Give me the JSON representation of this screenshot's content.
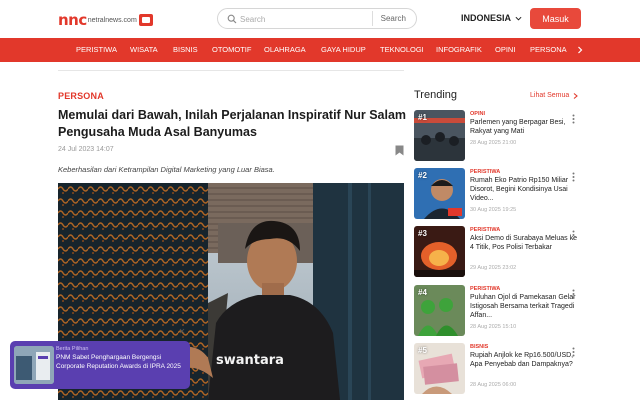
{
  "header": {
    "logo_text": "nnc",
    "logo_sub": "netralnews.com",
    "search_placeholder": "Search",
    "search_button": "Search",
    "language": "INDONESIA",
    "login_button": "Masuk"
  },
  "nav": {
    "items": [
      "PERISTIWA",
      "WISATA",
      "BISNIS",
      "OTOMOTIF",
      "OLAHRAGA",
      "GAYA HIDUP",
      "TEKNOLOGI",
      "INFOGRAFIK",
      "OPINI",
      "PERSONA"
    ]
  },
  "article": {
    "category": "PERSONA",
    "title": "Memulai dari Bawah, Inilah Perjalanan Inspiratif Nur Salam Pengusaha Muda Asal Banyumas",
    "date": "24 Jul 2023 14:07",
    "lead": "Keberhasilan dari Ketrampilan Digital Marketing yang Luar Biasa.",
    "photo_shirt_text": "swantara"
  },
  "promo": {
    "kicker": "Berita Pilihan",
    "title": "PNM Sabet Penghargaan Bergengsi Corporate Reputation Awards di IPRA 2025",
    "close": "✕"
  },
  "trending": {
    "heading": "Trending",
    "see_all": "Lihat Semua",
    "items": [
      {
        "rank": "#1",
        "category": "OPINI",
        "title": "Parlemen yang Berpagar Besi, Rakyat yang Mati",
        "date": "28 Aug 2025 21:00"
      },
      {
        "rank": "#2",
        "category": "PERISTIWA",
        "title": "Rumah Eko Patrio Rp150 Miliar Disorot, Begini Kondisinya Usai Video...",
        "date": "30 Aug 2025 19:25"
      },
      {
        "rank": "#3",
        "category": "PERISTIWA",
        "title": "Aksi Demo di Surabaya Meluas ke 4 Titik, Pos Polisi Terbakar",
        "date": "29 Aug 2025 23:02"
      },
      {
        "rank": "#4",
        "category": "PERISTIWA",
        "title": "Puluhan Ojol di Pamekasan Gelar Istigosah Bersama terkait Tragedi Affan...",
        "date": "28 Aug 2025 15:10"
      },
      {
        "rank": "#5",
        "category": "BISNIS",
        "title": "Rupiah Anjlok ke Rp16.500/USD, Apa Penyebab dan Dampaknya?",
        "date": "28 Aug 2025 06:00"
      }
    ]
  },
  "colors": {
    "brand_red": "#e2382b",
    "promo_purple": "#5a3fb0"
  },
  "icons": {
    "search": "search-icon",
    "language_chevron": "chevron-down-icon",
    "nav_next": "chevron-right-icon",
    "bookmark": "bookmark-icon",
    "more": "kebab-icon"
  }
}
